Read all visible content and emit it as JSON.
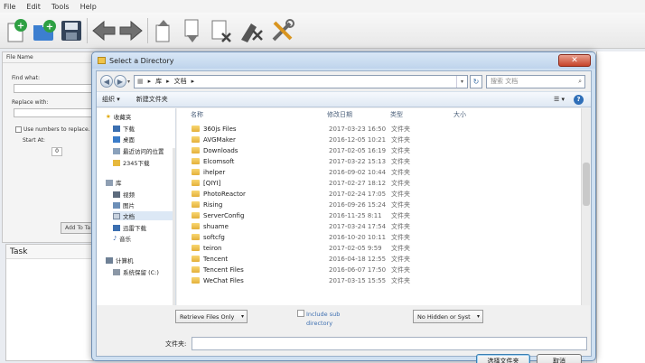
{
  "app": {
    "menu": [
      "File",
      "Edit",
      "Tools",
      "Help"
    ],
    "left_pane": {
      "header": "File Name",
      "find_label": "Find what:",
      "replace_label": "Replace with:",
      "use_numbers_label": "Use numbers to replace. If",
      "start_at_label": "Start At:",
      "start_at_value": "0",
      "add_button": "Add To Ta"
    },
    "task_title": "Task"
  },
  "dialog": {
    "title": "Select a Directory",
    "close_glyph": "✕",
    "breadcrumb": [
      "库",
      "文档"
    ],
    "search_placeholder": "搜索 文档",
    "organize_label": "组织 ▾",
    "new_folder_label": "新建文件夹",
    "help_glyph": "?",
    "nav": {
      "favorites": "收藏夹",
      "downloads": "下载",
      "desktop": "桌面",
      "recent": "最近访问的位置",
      "downloads2345": "2345下载",
      "libraries": "库",
      "videos": "视频",
      "pictures": "图片",
      "documents": "文档",
      "thunder": "迅雷下载",
      "music": "音乐",
      "computer": "计算机",
      "system_drive": "系统保留 (C:)"
    },
    "columns": {
      "name": "名称",
      "date": "修改日期",
      "type": "类型",
      "size": "大小"
    },
    "files": [
      {
        "name": "360js Files",
        "date": "2017-03-23 16:50",
        "type": "文件夹"
      },
      {
        "name": "AVGMaker",
        "date": "2016-12-05 10:21",
        "type": "文件夹"
      },
      {
        "name": "Downloads",
        "date": "2017-02-05 16:19",
        "type": "文件夹"
      },
      {
        "name": "Elcomsoft",
        "date": "2017-03-22 15:13",
        "type": "文件夹"
      },
      {
        "name": "ihelper",
        "date": "2016-09-02 10:44",
        "type": "文件夹"
      },
      {
        "name": "[QIYI]",
        "date": "2017-02-27 18:12",
        "type": "文件夹"
      },
      {
        "name": "PhotoReactor",
        "date": "2017-02-24 17:05",
        "type": "文件夹"
      },
      {
        "name": "Rising",
        "date": "2016-09-26 15:24",
        "type": "文件夹"
      },
      {
        "name": "ServerConfig",
        "date": "2016-11-25 8:11",
        "type": "文件夹"
      },
      {
        "name": "shuame",
        "date": "2017-03-24 17:54",
        "type": "文件夹"
      },
      {
        "name": "softcfg",
        "date": "2016-10-20 10:11",
        "type": "文件夹"
      },
      {
        "name": "teiron",
        "date": "2017-02-05 9:59",
        "type": "文件夹"
      },
      {
        "name": "Tencent",
        "date": "2016-04-18 12:55",
        "type": "文件夹"
      },
      {
        "name": "Tencent Files",
        "date": "2016-06-07 17:50",
        "type": "文件夹"
      },
      {
        "name": "WeChat Files",
        "date": "2017-03-15 15:55",
        "type": "文件夹"
      }
    ],
    "retrieve_select": "Retrieve Files Only",
    "include_sub_label": "Include sub directory",
    "hidden_select": "No Hidden or Syst",
    "filename_label": "文件夹:",
    "select_button": "选择文件夹",
    "cancel_button": "取消"
  }
}
